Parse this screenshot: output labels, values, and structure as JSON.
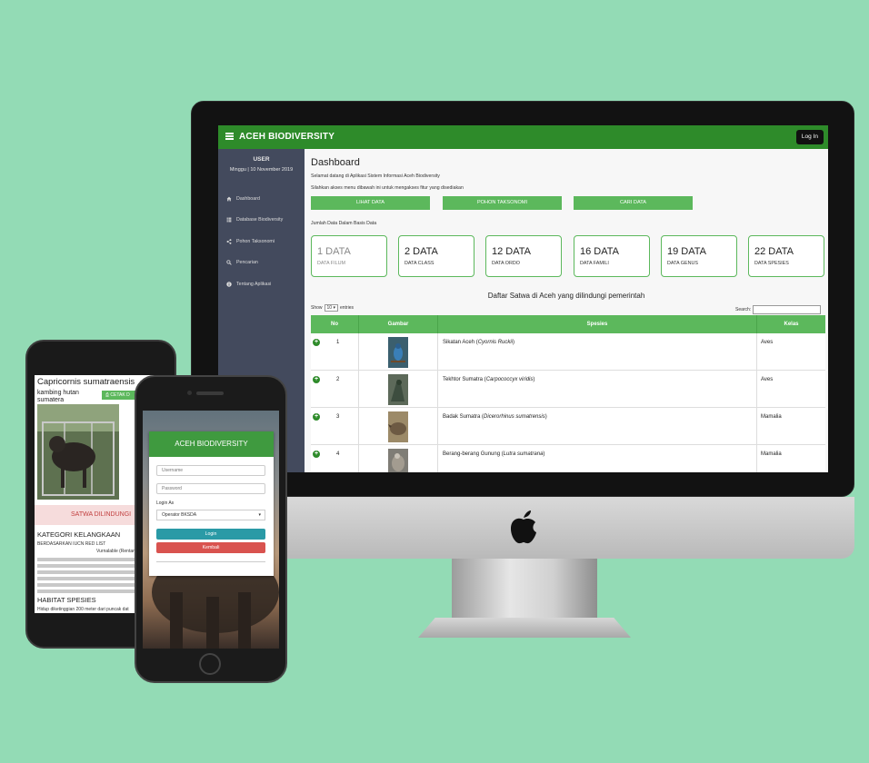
{
  "topbar": {
    "brand": "ACEH BIODIVERSITY",
    "login": "Log In"
  },
  "sidebar": {
    "user": "USER",
    "date": "Minggu | 10 November 2019",
    "items": [
      {
        "label": "Dashboard",
        "icon": "home-icon"
      },
      {
        "label": "Database Biodiversity",
        "icon": "list-icon"
      },
      {
        "label": "Pohon Taksonomi",
        "icon": "share-icon"
      },
      {
        "label": "Pencarian",
        "icon": "search-icon"
      },
      {
        "label": "Tentang Aplikasi",
        "icon": "info-icon"
      }
    ]
  },
  "main": {
    "title": "Dashboard",
    "welcome": "Selamat datang di Aplikasi Sistem Informasi Aceh Biodiversity",
    "info": "Silahkan akses menu dibawah ini untuk mengakses fitur yang disediakan",
    "buttons": [
      "LIHAT DATA",
      "POHON TAKSONOMI",
      "CARI DATA"
    ],
    "jumlah": "Jumlah Data Dalam Basis Data",
    "cards": [
      {
        "num": "1 DATA",
        "label": "DATA FILUM"
      },
      {
        "num": "2 DATA",
        "label": "DATA CLASS"
      },
      {
        "num": "12 DATA",
        "label": "DATA ORDO"
      },
      {
        "num": "16 DATA",
        "label": "DATA FAMILI"
      },
      {
        "num": "19 DATA",
        "label": "DATA GENUS"
      },
      {
        "num": "22 DATA",
        "label": "DATA SPESIES"
      }
    ],
    "table_title": "Daftar Satwa di Aceh yang dilindungi pemerintah",
    "show_label": "Show",
    "show_value": "10",
    "entries_label": "entries",
    "search_label": "Search:",
    "columns": [
      "No",
      "Gambar",
      "Spesies",
      "Kelas"
    ],
    "rows": [
      {
        "no": "1",
        "common": "Sikatan Aceh (",
        "latin": "Cyornis Ruckii",
        "kelas": "Aves"
      },
      {
        "no": "2",
        "common": "Tekhtor Sumatra (",
        "latin": "Carpococcyx viridis",
        "kelas": "Aves"
      },
      {
        "no": "3",
        "common": "Badak Sumatra (",
        "latin": "Dicerorhinus sumatrensis",
        "kelas": "Mamalia"
      },
      {
        "no": "4",
        "common": "Berang-berang Gunung (",
        "latin": "Lutra sumatrana",
        "kelas": "Mamalia"
      }
    ]
  },
  "phone_back": {
    "title": "Capricornis sumatraensis",
    "subtitle": "kambing hutan sumatera",
    "print_button": "CETAK D",
    "banner": "SATWA DILINDUNGI",
    "kategori_title": "KATEGORI KELANGKAAN",
    "kategori_sub": "BERDASARKAN IUCN RED LIST",
    "status": "Vurnalable (Rentan)",
    "habitat_title": "HABITAT SPESIES",
    "habitat_text": "Hidup diketinggian 200 meter dari puncak dat"
  },
  "phone_front": {
    "title": "ACEH BIODIVERSITY",
    "username_placeholder": "Username",
    "password_placeholder": "Password",
    "login_as": "Login As",
    "select_value": "Operator BKSDA",
    "login_button": "Login",
    "back_button": "Kembali"
  },
  "colors": {
    "accent": "#5cb85c",
    "topbar": "#2e8b2a",
    "sidebar": "#434a5d",
    "danger": "#d9534f",
    "teal": "#2a9aa6",
    "background": "#93dbb5"
  }
}
